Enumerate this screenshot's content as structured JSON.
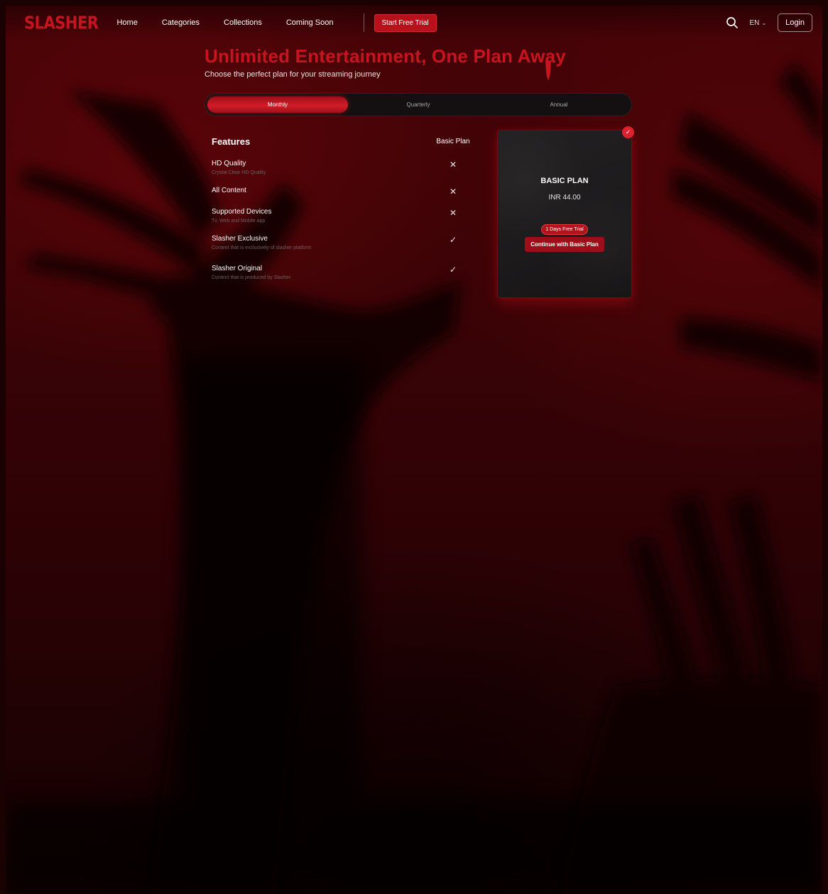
{
  "nav": {
    "logo": "SLASHER",
    "links": [
      "Home",
      "Categories",
      "Collections",
      "Coming Soon"
    ],
    "trial_button": "Start Free Trial",
    "language": "EN",
    "login": "Login"
  },
  "hero": {
    "title": "Unlimited Entertainment, One Plan Away",
    "subtitle": "Choose the perfect plan for your streaming journey"
  },
  "tabs": [
    {
      "label": "Monthly",
      "active": true
    },
    {
      "label": "Quarterly",
      "active": false
    },
    {
      "label": "Annual",
      "active": false
    }
  ],
  "features": {
    "title": "Features",
    "plan_column": "Basic Plan",
    "rows": [
      {
        "name": "HD Quality",
        "desc": "Crystal Clear HD Quality",
        "included": false
      },
      {
        "name": "All Content",
        "desc": "",
        "included": false
      },
      {
        "name": "Supported Devices",
        "desc": "Tv, Web and Mobile app",
        "included": false
      },
      {
        "name": "Slasher Exclusive",
        "desc": "Content that is exclusively of slasher platform",
        "included": true
      },
      {
        "name": "Slasher Original",
        "desc": "Content that is produced by Slasher",
        "included": true
      }
    ]
  },
  "plan_card": {
    "name": "BASIC PLAN",
    "price": "INR 44.00",
    "trial_badge": "1 Days Free Trial",
    "cta": "Continue with Basic Plan",
    "selected": true
  },
  "colors": {
    "accent": "#c8141f",
    "background": "#3a0306",
    "card": "#1c1a1b"
  },
  "icons": {
    "search": "search-icon",
    "chevron": "chevron-down-icon",
    "check": "check-icon",
    "cross": "close-icon"
  }
}
